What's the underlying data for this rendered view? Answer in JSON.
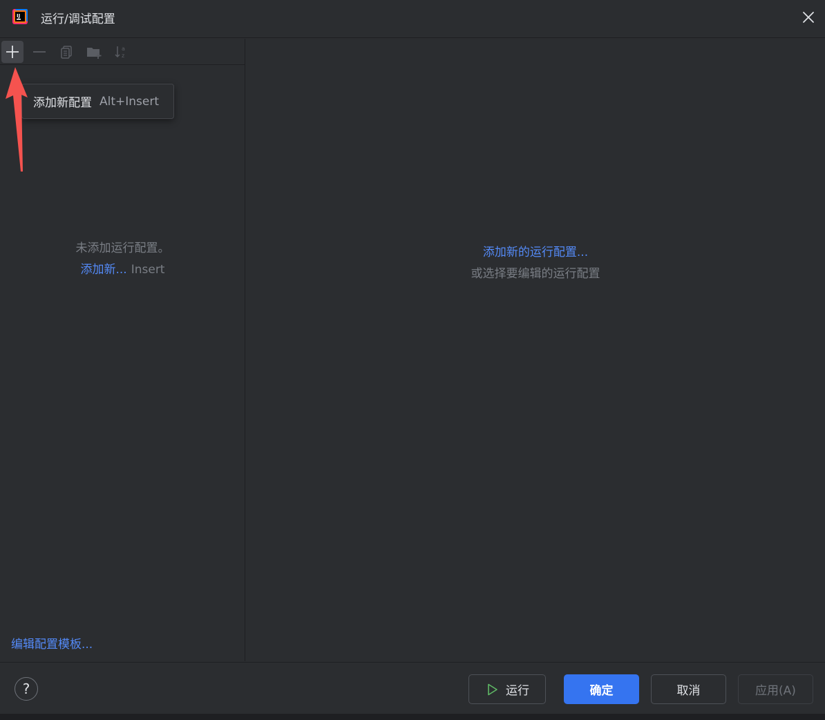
{
  "window": {
    "title": "运行/调试配置"
  },
  "toolbar": {
    "buttons": [
      {
        "icon": "plus-icon",
        "label": "添加"
      },
      {
        "icon": "minus-icon",
        "label": "移除"
      },
      {
        "icon": "copy-icon",
        "label": "复制"
      },
      {
        "icon": "new-folder-icon",
        "label": "新建文件夹"
      },
      {
        "icon": "sort-alpha-icon",
        "label": "排序"
      }
    ]
  },
  "tooltip": {
    "label": "添加新配置",
    "shortcut": "Alt+Insert"
  },
  "left_empty": {
    "message": "未添加运行配置。",
    "add_link": "添加新...",
    "add_shortcut": "Insert"
  },
  "left_footer": {
    "templates_link": "编辑配置模板..."
  },
  "right_empty": {
    "add_link": "添加新的运行配置...",
    "hint": "或选择要编辑的运行配置"
  },
  "footer": {
    "help": "?",
    "run_label": "运行",
    "ok_label": "确定",
    "cancel_label": "取消",
    "apply_label": "应用(A)"
  },
  "colors": {
    "background": "#2b2d30",
    "link": "#548af7",
    "primary_button": "#3574f0",
    "annotation_arrow": "#f5534f",
    "run_icon": "#5fb865"
  }
}
